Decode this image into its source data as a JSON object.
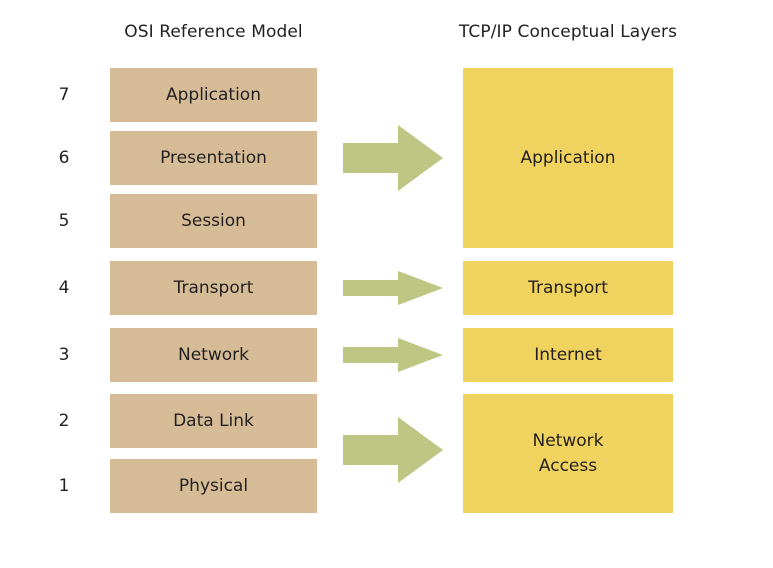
{
  "headings": {
    "left": "OSI Reference Model",
    "right": "TCP/IP Conceptual Layers"
  },
  "colors": {
    "osi_box": "#D6BC96",
    "tcpip_box": "#F0D25E",
    "arrow": "#BDC683",
    "text": "#231F20",
    "background": "#FFFFFF"
  },
  "osi_layers": [
    {
      "number": "7",
      "label": "Application"
    },
    {
      "number": "6",
      "label": "Presentation"
    },
    {
      "number": "5",
      "label": "Session"
    },
    {
      "number": "4",
      "label": "Transport"
    },
    {
      "number": "3",
      "label": "Network"
    },
    {
      "number": "2",
      "label": "Data Link"
    },
    {
      "number": "1",
      "label": "Physical"
    }
  ],
  "tcpip_layers": [
    {
      "label": "Application",
      "spans_osi": [
        "7",
        "6",
        "5"
      ]
    },
    {
      "label": "Transport",
      "spans_osi": [
        "4"
      ]
    },
    {
      "label": "Internet",
      "spans_osi": [
        "3"
      ]
    },
    {
      "label": "Network\nAccess",
      "label_line1": "Network",
      "label_line2": "Access",
      "spans_osi": [
        "2",
        "1"
      ]
    }
  ],
  "mappings": [
    {
      "from": "Application / Presentation / Session",
      "to": "Application"
    },
    {
      "from": "Transport",
      "to": "Transport"
    },
    {
      "from": "Network",
      "to": "Internet"
    },
    {
      "from": "Data Link / Physical",
      "to": "Network Access"
    }
  ]
}
